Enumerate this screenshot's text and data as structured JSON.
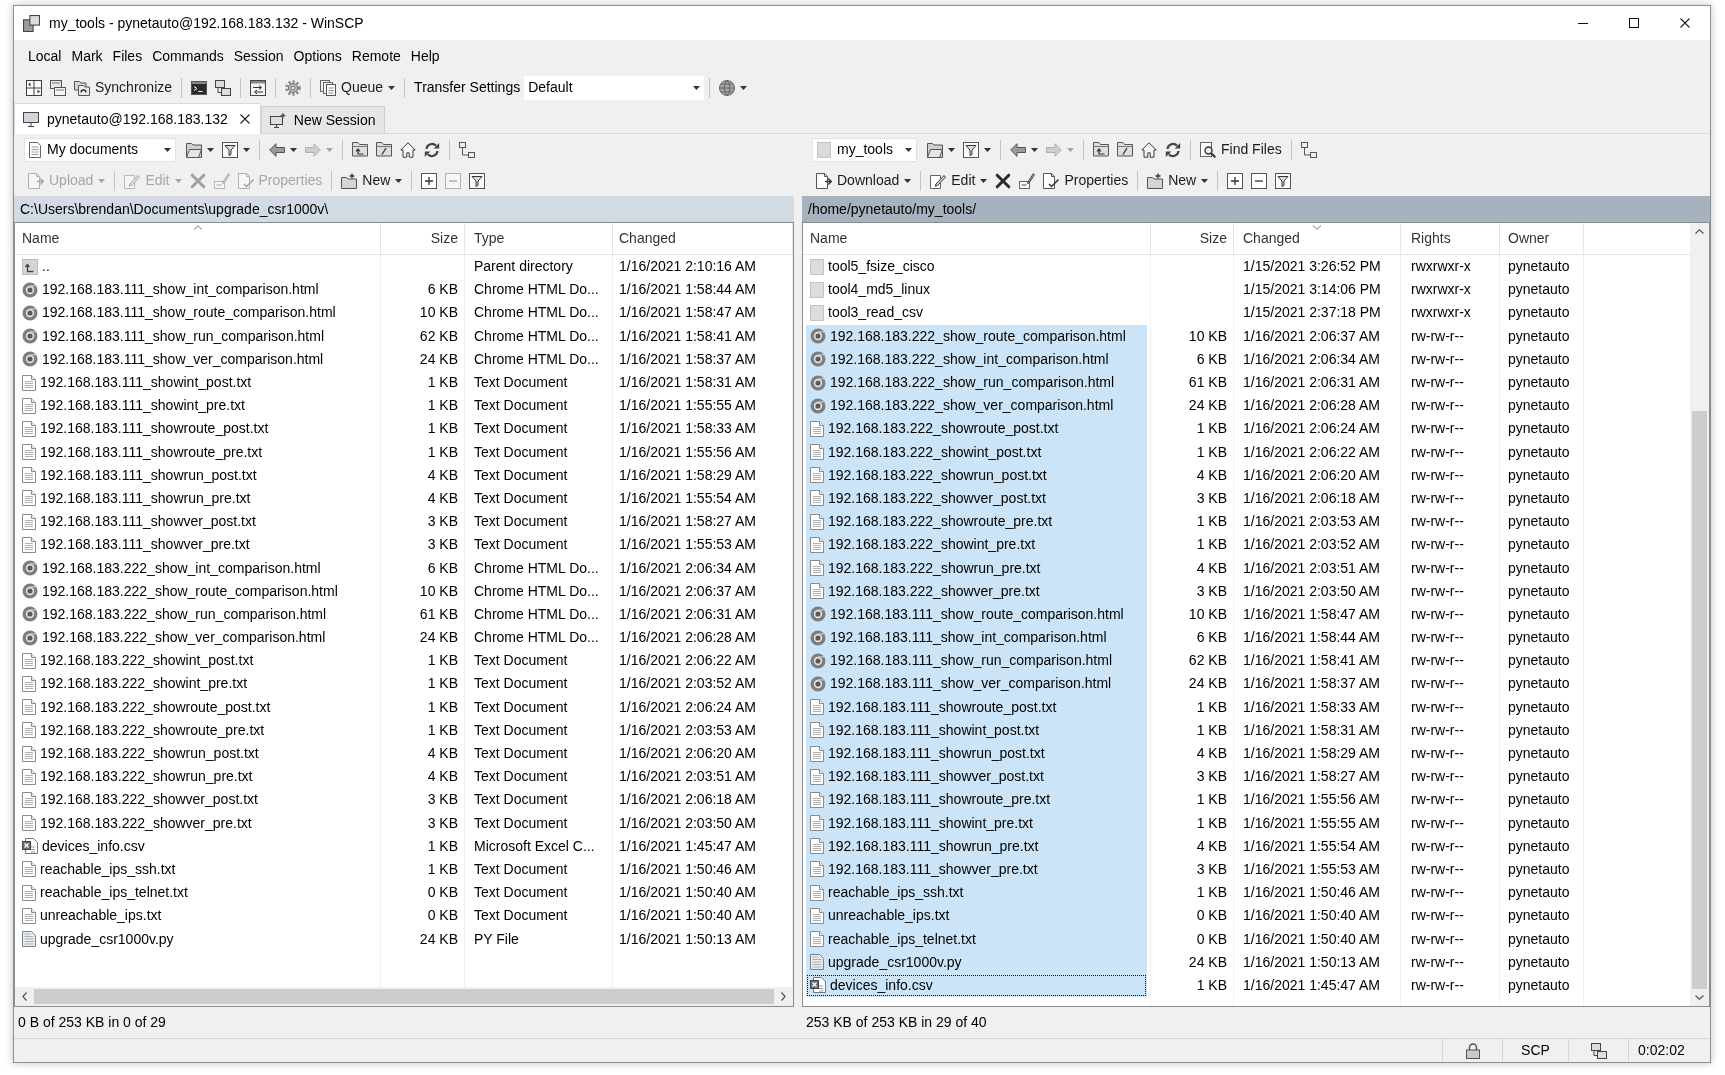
{
  "window": {
    "title": "my_tools - pynetauto@192.168.183.132 - WinSCP"
  },
  "menu": [
    "Local",
    "Mark",
    "Files",
    "Commands",
    "Session",
    "Options",
    "Remote",
    "Help"
  ],
  "toolbar": {
    "groups": [
      [
        {
          "kind": "compare",
          "dropdown": false
        },
        {
          "kind": "browse",
          "dropdown": false
        },
        {
          "kind": "synchronize",
          "label": "Synchronize",
          "dropdown": false
        }
      ],
      [
        {
          "kind": "terminal",
          "dropdown": false
        },
        {
          "kind": "linked",
          "dropdown": false
        }
      ],
      [
        {
          "kind": "swap",
          "dropdown": false
        }
      ],
      [
        {
          "kind": "preferences",
          "dropdown": false
        }
      ],
      [
        {
          "kind": "queue",
          "label": "Queue",
          "dropdown": true
        }
      ],
      [
        {
          "kind": "transfer",
          "label": "Transfer Settings",
          "value": "Default"
        }
      ],
      [
        {
          "kind": "globe",
          "dropdown": true
        }
      ]
    ]
  },
  "sessions": [
    {
      "kind": "session",
      "label": "pynetauto@192.168.183.132",
      "selected": true,
      "closable": true
    },
    {
      "kind": "new",
      "label": "New Session",
      "selected": false,
      "closable": false
    }
  ],
  "panels": [
    {
      "active": false,
      "location": {
        "kind": "documents",
        "label": "My documents"
      },
      "nav_groups": [
        [
          {
            "kind": "open",
            "dropdown": true,
            "disabled": false
          },
          {
            "kind": "filter",
            "dropdown": true,
            "disabled": false
          }
        ],
        [
          {
            "kind": "back",
            "dropdown": true,
            "disabled": false
          },
          {
            "kind": "forward",
            "dropdown": true,
            "disabled": true
          }
        ],
        [
          {
            "kind": "parent",
            "dropdown": false,
            "disabled": false
          },
          {
            "kind": "root",
            "dropdown": false,
            "disabled": false
          },
          {
            "kind": "home",
            "dropdown": false,
            "disabled": false
          },
          {
            "kind": "refresh",
            "dropdown": false,
            "disabled": false
          }
        ],
        [
          {
            "kind": "tree",
            "dropdown": false,
            "disabled": false
          }
        ]
      ],
      "file_groups": [
        [
          {
            "kind": "upload",
            "label": "Upload",
            "dropdown": true,
            "disabled": true
          }
        ],
        [
          {
            "kind": "edit",
            "label": "Edit",
            "dropdown": true,
            "disabled": true
          },
          {
            "kind": "delete",
            "dropdown": false,
            "disabled": true
          },
          {
            "kind": "rename",
            "dropdown": false,
            "disabled": true
          },
          {
            "kind": "properties",
            "label": "Properties",
            "dropdown": false,
            "disabled": true
          }
        ],
        [
          {
            "kind": "new",
            "label": "New",
            "dropdown": true,
            "disabled": false
          }
        ],
        [
          {
            "kind": "select",
            "dropdown": false,
            "disabled": false
          },
          {
            "kind": "unselect",
            "dropdown": false,
            "disabled": true
          },
          {
            "kind": "mask",
            "dropdown": false,
            "disabled": false
          }
        ]
      ],
      "path": "C:\\Users\\brendan\\Documents\\upgrade_csr1000v\\",
      "columns": [
        {
          "label": "Name",
          "sorted": true,
          "descending": false
        },
        {
          "label": "Size",
          "sorted": false
        },
        {
          "label": "Type",
          "sorted": false
        },
        {
          "label": "Changed",
          "sorted": false
        }
      ],
      "rows": [
        {
          "kind": "parent",
          "name": "..",
          "type": "Parent directory",
          "changed": "1/16/2021 2:10:16 AM",
          "selected": false
        },
        {
          "kind": "html",
          "name": "192.168.183.111_show_int_comparison.html",
          "size": "6 KB",
          "type": "Chrome HTML Do...",
          "changed": "1/16/2021 1:58:44 AM",
          "selected": false
        },
        {
          "kind": "html",
          "name": "192.168.183.111_show_route_comparison.html",
          "size": "10 KB",
          "type": "Chrome HTML Do...",
          "changed": "1/16/2021 1:58:47 AM",
          "selected": false
        },
        {
          "kind": "html",
          "name": "192.168.183.111_show_run_comparison.html",
          "size": "62 KB",
          "type": "Chrome HTML Do...",
          "changed": "1/16/2021 1:58:41 AM",
          "selected": false
        },
        {
          "kind": "html",
          "name": "192.168.183.111_show_ver_comparison.html",
          "size": "24 KB",
          "type": "Chrome HTML Do...",
          "changed": "1/16/2021 1:58:37 AM",
          "selected": false
        },
        {
          "kind": "text",
          "name": "192.168.183.111_showint_post.txt",
          "size": "1 KB",
          "type": "Text Document",
          "changed": "1/16/2021 1:58:31 AM",
          "selected": false
        },
        {
          "kind": "text",
          "name": "192.168.183.111_showint_pre.txt",
          "size": "1 KB",
          "type": "Text Document",
          "changed": "1/16/2021 1:55:55 AM",
          "selected": false
        },
        {
          "kind": "text",
          "name": "192.168.183.111_showroute_post.txt",
          "size": "1 KB",
          "type": "Text Document",
          "changed": "1/16/2021 1:58:33 AM",
          "selected": false
        },
        {
          "kind": "text",
          "name": "192.168.183.111_showroute_pre.txt",
          "size": "1 KB",
          "type": "Text Document",
          "changed": "1/16/2021 1:55:56 AM",
          "selected": false
        },
        {
          "kind": "text",
          "name": "192.168.183.111_showrun_post.txt",
          "size": "4 KB",
          "type": "Text Document",
          "changed": "1/16/2021 1:58:29 AM",
          "selected": false
        },
        {
          "kind": "text",
          "name": "192.168.183.111_showrun_pre.txt",
          "size": "4 KB",
          "type": "Text Document",
          "changed": "1/16/2021 1:55:54 AM",
          "selected": false
        },
        {
          "kind": "text",
          "name": "192.168.183.111_showver_post.txt",
          "size": "3 KB",
          "type": "Text Document",
          "changed": "1/16/2021 1:58:27 AM",
          "selected": false
        },
        {
          "kind": "text",
          "name": "192.168.183.111_showver_pre.txt",
          "size": "3 KB",
          "type": "Text Document",
          "changed": "1/16/2021 1:55:53 AM",
          "selected": false
        },
        {
          "kind": "html",
          "name": "192.168.183.222_show_int_comparison.html",
          "size": "6 KB",
          "type": "Chrome HTML Do...",
          "changed": "1/16/2021 2:06:34 AM",
          "selected": false
        },
        {
          "kind": "html",
          "name": "192.168.183.222_show_route_comparison.html",
          "size": "10 KB",
          "type": "Chrome HTML Do...",
          "changed": "1/16/2021 2:06:37 AM",
          "selected": false
        },
        {
          "kind": "html",
          "name": "192.168.183.222_show_run_comparison.html",
          "size": "61 KB",
          "type": "Chrome HTML Do...",
          "changed": "1/16/2021 2:06:31 AM",
          "selected": false
        },
        {
          "kind": "html",
          "name": "192.168.183.222_show_ver_comparison.html",
          "size": "24 KB",
          "type": "Chrome HTML Do...",
          "changed": "1/16/2021 2:06:28 AM",
          "selected": false
        },
        {
          "kind": "text",
          "name": "192.168.183.222_showint_post.txt",
          "size": "1 KB",
          "type": "Text Document",
          "changed": "1/16/2021 2:06:22 AM",
          "selected": false
        },
        {
          "kind": "text",
          "name": "192.168.183.222_showint_pre.txt",
          "size": "1 KB",
          "type": "Text Document",
          "changed": "1/16/2021 2:03:52 AM",
          "selected": false
        },
        {
          "kind": "text",
          "name": "192.168.183.222_showroute_post.txt",
          "size": "1 KB",
          "type": "Text Document",
          "changed": "1/16/2021 2:06:24 AM",
          "selected": false
        },
        {
          "kind": "text",
          "name": "192.168.183.222_showroute_pre.txt",
          "size": "1 KB",
          "type": "Text Document",
          "changed": "1/16/2021 2:03:53 AM",
          "selected": false
        },
        {
          "kind": "text",
          "name": "192.168.183.222_showrun_post.txt",
          "size": "4 KB",
          "type": "Text Document",
          "changed": "1/16/2021 2:06:20 AM",
          "selected": false
        },
        {
          "kind": "text",
          "name": "192.168.183.222_showrun_pre.txt",
          "size": "4 KB",
          "type": "Text Document",
          "changed": "1/16/2021 2:03:51 AM",
          "selected": false
        },
        {
          "kind": "text",
          "name": "192.168.183.222_showver_post.txt",
          "size": "3 KB",
          "type": "Text Document",
          "changed": "1/16/2021 2:06:18 AM",
          "selected": false
        },
        {
          "kind": "text",
          "name": "192.168.183.222_showver_pre.txt",
          "size": "3 KB",
          "type": "Text Document",
          "changed": "1/16/2021 2:03:50 AM",
          "selected": false
        },
        {
          "kind": "csv",
          "name": "devices_info.csv",
          "size": "1 KB",
          "type": "Microsoft Excel C...",
          "changed": "1/16/2021 1:45:47 AM",
          "selected": false
        },
        {
          "kind": "text",
          "name": "reachable_ips_ssh.txt",
          "size": "1 KB",
          "type": "Text Document",
          "changed": "1/16/2021 1:50:46 AM",
          "selected": false
        },
        {
          "kind": "text",
          "name": "reachable_ips_telnet.txt",
          "size": "0 KB",
          "type": "Text Document",
          "changed": "1/16/2021 1:50:40 AM",
          "selected": false
        },
        {
          "kind": "text",
          "name": "unreachable_ips.txt",
          "size": "0 KB",
          "type": "Text Document",
          "changed": "1/16/2021 1:50:40 AM",
          "selected": false
        },
        {
          "kind": "python",
          "name": "upgrade_csr1000v.py",
          "size": "24 KB",
          "type": "PY File",
          "changed": "1/16/2021 1:50:13 AM",
          "selected": false
        }
      ],
      "status": "0 B of 253 KB in 0 of 29"
    },
    {
      "active": true,
      "location": {
        "kind": "folder",
        "label": "my_tools"
      },
      "nav_groups": [
        [
          {
            "kind": "open",
            "dropdown": true,
            "disabled": false
          },
          {
            "kind": "filter",
            "dropdown": true,
            "disabled": false
          }
        ],
        [
          {
            "kind": "back",
            "dropdown": true,
            "disabled": false
          },
          {
            "kind": "forward",
            "dropdown": true,
            "disabled": true
          }
        ],
        [
          {
            "kind": "parent",
            "dropdown": false,
            "disabled": false
          },
          {
            "kind": "root",
            "dropdown": false,
            "disabled": false
          },
          {
            "kind": "home",
            "dropdown": false,
            "disabled": false
          },
          {
            "kind": "refresh",
            "dropdown": false,
            "disabled": false
          }
        ],
        [
          {
            "kind": "find",
            "label": "Find Files",
            "dropdown": false,
            "disabled": false
          }
        ],
        [
          {
            "kind": "tree",
            "dropdown": false,
            "disabled": false
          }
        ]
      ],
      "file_groups": [
        [
          {
            "kind": "download",
            "label": "Download",
            "dropdown": true,
            "disabled": false
          }
        ],
        [
          {
            "kind": "edit",
            "label": "Edit",
            "dropdown": true,
            "disabled": false
          },
          {
            "kind": "delete",
            "dropdown": false,
            "disabled": false
          },
          {
            "kind": "rename",
            "dropdown": false,
            "disabled": false
          },
          {
            "kind": "properties",
            "label": "Properties",
            "dropdown": false,
            "disabled": false
          }
        ],
        [
          {
            "kind": "new",
            "label": "New",
            "dropdown": true,
            "disabled": false
          }
        ],
        [
          {
            "kind": "select",
            "dropdown": false,
            "disabled": false
          },
          {
            "kind": "unselect",
            "dropdown": false,
            "disabled": false
          },
          {
            "kind": "mask",
            "dropdown": false,
            "disabled": false
          }
        ]
      ],
      "path": "/home/pynetauto/my_tools/",
      "columns": [
        {
          "label": "Name",
          "sorted": false
        },
        {
          "label": "Size",
          "sorted": false
        },
        {
          "label": "Changed",
          "sorted": true,
          "descending": true
        },
        {
          "label": "Rights",
          "sorted": false
        },
        {
          "label": "Owner",
          "sorted": false
        }
      ],
      "rows": [
        {
          "kind": "file",
          "name": "tool5_fsize_cisco",
          "changed": "1/15/2021 3:26:52 PM",
          "rights": "rwxrwxr-x",
          "owner": "pynetauto",
          "selected": false,
          "focused": false
        },
        {
          "kind": "file",
          "name": "tool4_md5_linux",
          "changed": "1/15/2021 3:14:06 PM",
          "rights": "rwxrwxr-x",
          "owner": "pynetauto",
          "selected": false,
          "focused": false
        },
        {
          "kind": "file",
          "name": "tool3_read_csv",
          "changed": "1/15/2021 2:37:18 PM",
          "rights": "rwxrwxr-x",
          "owner": "pynetauto",
          "selected": false,
          "focused": false
        },
        {
          "kind": "html",
          "name": "192.168.183.222_show_route_comparison.html",
          "size": "10 KB",
          "changed": "1/16/2021 2:06:37 AM",
          "rights": "rw-rw-r--",
          "owner": "pynetauto",
          "selected": true,
          "focused": false
        },
        {
          "kind": "html",
          "name": "192.168.183.222_show_int_comparison.html",
          "size": "6 KB",
          "changed": "1/16/2021 2:06:34 AM",
          "rights": "rw-rw-r--",
          "owner": "pynetauto",
          "selected": true,
          "focused": false
        },
        {
          "kind": "html",
          "name": "192.168.183.222_show_run_comparison.html",
          "size": "61 KB",
          "changed": "1/16/2021 2:06:31 AM",
          "rights": "rw-rw-r--",
          "owner": "pynetauto",
          "selected": true,
          "focused": false
        },
        {
          "kind": "html",
          "name": "192.168.183.222_show_ver_comparison.html",
          "size": "24 KB",
          "changed": "1/16/2021 2:06:28 AM",
          "rights": "rw-rw-r--",
          "owner": "pynetauto",
          "selected": true,
          "focused": false
        },
        {
          "kind": "text",
          "name": "192.168.183.222_showroute_post.txt",
          "size": "1 KB",
          "changed": "1/16/2021 2:06:24 AM",
          "rights": "rw-rw-r--",
          "owner": "pynetauto",
          "selected": true,
          "focused": false
        },
        {
          "kind": "text",
          "name": "192.168.183.222_showint_post.txt",
          "size": "1 KB",
          "changed": "1/16/2021 2:06:22 AM",
          "rights": "rw-rw-r--",
          "owner": "pynetauto",
          "selected": true,
          "focused": false
        },
        {
          "kind": "text",
          "name": "192.168.183.222_showrun_post.txt",
          "size": "4 KB",
          "changed": "1/16/2021 2:06:20 AM",
          "rights": "rw-rw-r--",
          "owner": "pynetauto",
          "selected": true,
          "focused": false
        },
        {
          "kind": "text",
          "name": "192.168.183.222_showver_post.txt",
          "size": "3 KB",
          "changed": "1/16/2021 2:06:18 AM",
          "rights": "rw-rw-r--",
          "owner": "pynetauto",
          "selected": true,
          "focused": false
        },
        {
          "kind": "text",
          "name": "192.168.183.222_showroute_pre.txt",
          "size": "1 KB",
          "changed": "1/16/2021 2:03:53 AM",
          "rights": "rw-rw-r--",
          "owner": "pynetauto",
          "selected": true,
          "focused": false
        },
        {
          "kind": "text",
          "name": "192.168.183.222_showint_pre.txt",
          "size": "1 KB",
          "changed": "1/16/2021 2:03:52 AM",
          "rights": "rw-rw-r--",
          "owner": "pynetauto",
          "selected": true,
          "focused": false
        },
        {
          "kind": "text",
          "name": "192.168.183.222_showrun_pre.txt",
          "size": "4 KB",
          "changed": "1/16/2021 2:03:51 AM",
          "rights": "rw-rw-r--",
          "owner": "pynetauto",
          "selected": true,
          "focused": false
        },
        {
          "kind": "text",
          "name": "192.168.183.222_showver_pre.txt",
          "size": "3 KB",
          "changed": "1/16/2021 2:03:50 AM",
          "rights": "rw-rw-r--",
          "owner": "pynetauto",
          "selected": true,
          "focused": false
        },
        {
          "kind": "html",
          "name": "192.168.183.111_show_route_comparison.html",
          "size": "10 KB",
          "changed": "1/16/2021 1:58:47 AM",
          "rights": "rw-rw-r--",
          "owner": "pynetauto",
          "selected": true,
          "focused": false
        },
        {
          "kind": "html",
          "name": "192.168.183.111_show_int_comparison.html",
          "size": "6 KB",
          "changed": "1/16/2021 1:58:44 AM",
          "rights": "rw-rw-r--",
          "owner": "pynetauto",
          "selected": true,
          "focused": false
        },
        {
          "kind": "html",
          "name": "192.168.183.111_show_run_comparison.html",
          "size": "62 KB",
          "changed": "1/16/2021 1:58:41 AM",
          "rights": "rw-rw-r--",
          "owner": "pynetauto",
          "selected": true,
          "focused": false
        },
        {
          "kind": "html",
          "name": "192.168.183.111_show_ver_comparison.html",
          "size": "24 KB",
          "changed": "1/16/2021 1:58:37 AM",
          "rights": "rw-rw-r--",
          "owner": "pynetauto",
          "selected": true,
          "focused": false
        },
        {
          "kind": "text",
          "name": "192.168.183.111_showroute_post.txt",
          "size": "1 KB",
          "changed": "1/16/2021 1:58:33 AM",
          "rights": "rw-rw-r--",
          "owner": "pynetauto",
          "selected": true,
          "focused": false
        },
        {
          "kind": "text",
          "name": "192.168.183.111_showint_post.txt",
          "size": "1 KB",
          "changed": "1/16/2021 1:58:31 AM",
          "rights": "rw-rw-r--",
          "owner": "pynetauto",
          "selected": true,
          "focused": false
        },
        {
          "kind": "text",
          "name": "192.168.183.111_showrun_post.txt",
          "size": "4 KB",
          "changed": "1/16/2021 1:58:29 AM",
          "rights": "rw-rw-r--",
          "owner": "pynetauto",
          "selected": true,
          "focused": false
        },
        {
          "kind": "text",
          "name": "192.168.183.111_showver_post.txt",
          "size": "3 KB",
          "changed": "1/16/2021 1:58:27 AM",
          "rights": "rw-rw-r--",
          "owner": "pynetauto",
          "selected": true,
          "focused": false
        },
        {
          "kind": "text",
          "name": "192.168.183.111_showroute_pre.txt",
          "size": "1 KB",
          "changed": "1/16/2021 1:55:56 AM",
          "rights": "rw-rw-r--",
          "owner": "pynetauto",
          "selected": true,
          "focused": false
        },
        {
          "kind": "text",
          "name": "192.168.183.111_showint_pre.txt",
          "size": "1 KB",
          "changed": "1/16/2021 1:55:55 AM",
          "rights": "rw-rw-r--",
          "owner": "pynetauto",
          "selected": true,
          "focused": false
        },
        {
          "kind": "text",
          "name": "192.168.183.111_showrun_pre.txt",
          "size": "4 KB",
          "changed": "1/16/2021 1:55:54 AM",
          "rights": "rw-rw-r--",
          "owner": "pynetauto",
          "selected": true,
          "focused": false
        },
        {
          "kind": "text",
          "name": "192.168.183.111_showver_pre.txt",
          "size": "3 KB",
          "changed": "1/16/2021 1:55:53 AM",
          "rights": "rw-rw-r--",
          "owner": "pynetauto",
          "selected": true,
          "focused": false
        },
        {
          "kind": "text",
          "name": "reachable_ips_ssh.txt",
          "size": "1 KB",
          "changed": "1/16/2021 1:50:46 AM",
          "rights": "rw-rw-r--",
          "owner": "pynetauto",
          "selected": true,
          "focused": false
        },
        {
          "kind": "text",
          "name": "unreachable_ips.txt",
          "size": "0 KB",
          "changed": "1/16/2021 1:50:40 AM",
          "rights": "rw-rw-r--",
          "owner": "pynetauto",
          "selected": true,
          "focused": false
        },
        {
          "kind": "text",
          "name": "reachable_ips_telnet.txt",
          "size": "0 KB",
          "changed": "1/16/2021 1:50:40 AM",
          "rights": "rw-rw-r--",
          "owner": "pynetauto",
          "selected": true,
          "focused": false
        },
        {
          "kind": "python",
          "name": "upgrade_csr1000v.py",
          "size": "24 KB",
          "changed": "1/16/2021 1:50:13 AM",
          "rights": "rw-rw-r--",
          "owner": "pynetauto",
          "selected": true,
          "focused": false
        },
        {
          "kind": "csv",
          "name": "devices_info.csv",
          "size": "1 KB",
          "changed": "1/16/2021 1:45:47 AM",
          "rights": "rw-rw-r--",
          "owner": "pynetauto",
          "selected": true,
          "focused": true
        }
      ],
      "status": "253 KB of 253 KB in 29 of 40"
    }
  ],
  "status_bar": {
    "protocol": "SCP",
    "elapsed_time": "0:02:02"
  }
}
